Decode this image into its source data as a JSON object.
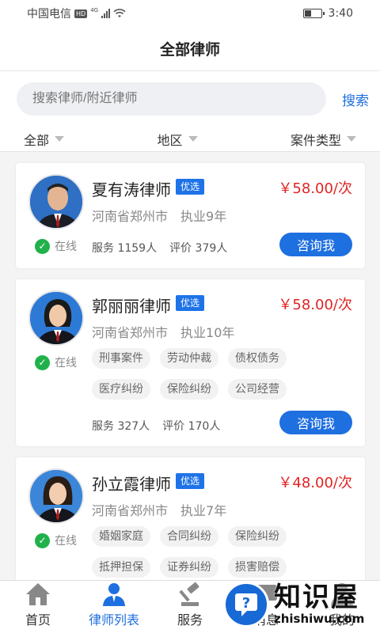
{
  "status_bar": {
    "carrier": "中国电信",
    "network": "4G",
    "hd": "HD",
    "time": "3:40"
  },
  "header": {
    "title": "全部律师"
  },
  "search": {
    "placeholder": "搜索律师/附近律师",
    "button": "搜索"
  },
  "filters": [
    {
      "label": "全部"
    },
    {
      "label": "地区"
    },
    {
      "label": "案件类型"
    }
  ],
  "lawyers": [
    {
      "name": "夏有涛律师",
      "badge": "优选",
      "price": "￥58.00/次",
      "location": "河南省郑州市",
      "experience": "执业9年",
      "status": "在线",
      "tags": [],
      "service": "服务 1159人",
      "rating": "评价 379人",
      "button": "咨询我"
    },
    {
      "name": "郭丽丽律师",
      "badge": "优选",
      "price": "￥58.00/次",
      "location": "河南省郑州市",
      "experience": "执业10年",
      "status": "在线",
      "tags": [
        "刑事案件",
        "劳动仲裁",
        "债权债务",
        "医疗纠纷",
        "保险纠纷",
        "公司经营"
      ],
      "service": "服务 327人",
      "rating": "评价 170人",
      "button": "咨询我"
    },
    {
      "name": "孙立霞律师",
      "badge": "优选",
      "price": "￥48.00/次",
      "location": "河南省郑州市",
      "experience": "执业7年",
      "status": "在线",
      "tags": [
        "婚姻家庭",
        "合同纠纷",
        "保险纠纷",
        "抵押担保",
        "证券纠纷",
        "损害赔偿"
      ]
    }
  ],
  "tabbar": [
    {
      "label": "首页",
      "icon": "home-icon"
    },
    {
      "label": "律师列表",
      "icon": "lawyer-icon"
    },
    {
      "label": "服务",
      "icon": "gavel-icon"
    },
    {
      "label": "消息",
      "icon": "message-icon"
    },
    {
      "label": "我的",
      "icon": "user-icon"
    }
  ],
  "watermark": {
    "title": "知识屋",
    "subtitle": "zhishiwu.com"
  },
  "colors": {
    "accent": "#1e6fe0",
    "price": "#e02424",
    "online": "#21b14b"
  }
}
